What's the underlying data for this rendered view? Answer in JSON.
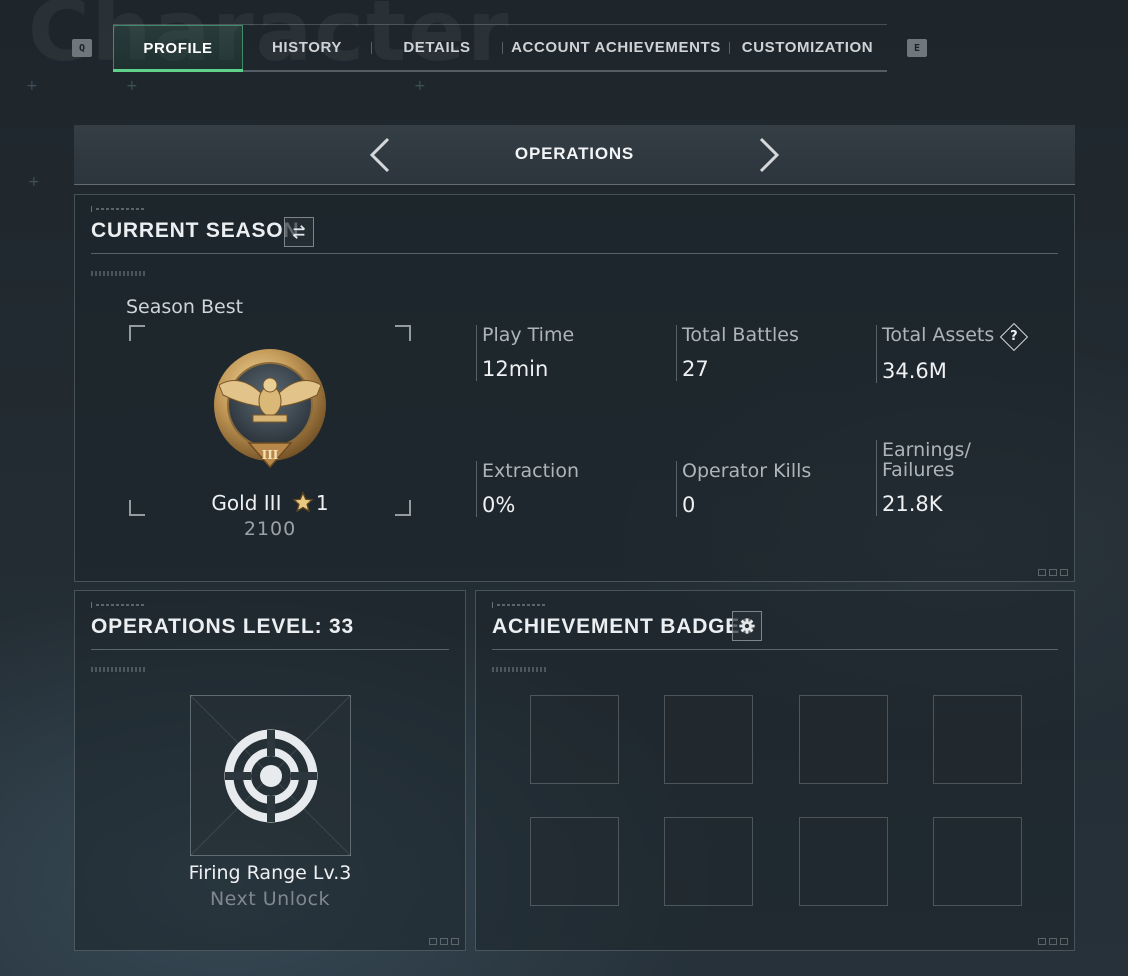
{
  "background_title": "Character",
  "tabs": {
    "prev_key": "Q",
    "next_key": "E",
    "items": [
      {
        "label": "PROFILE",
        "active": true
      },
      {
        "label": "HISTORY",
        "active": false
      },
      {
        "label": "DETAILS",
        "active": false
      },
      {
        "label": "ACCOUNT ACHIEVEMENTS",
        "active": false
      },
      {
        "label": "CUSTOMIZATION",
        "active": false
      }
    ]
  },
  "mode_selector": {
    "title": "OPERATIONS",
    "prev_icon": "chevron-left-icon",
    "next_icon": "chevron-right-icon"
  },
  "current_season": {
    "title": "CURRENT SEASON",
    "switch_icon": "swap-icon",
    "season_best_label": "Season Best",
    "rank": {
      "name": "Gold III",
      "stars": "1",
      "score": "2100",
      "medal_numeral": "III",
      "medal_icon": "gold-eagle-medal-icon"
    },
    "stats": [
      {
        "label": "Play Time",
        "value": "12min"
      },
      {
        "label": "Total Battles",
        "value": "27"
      },
      {
        "label": "Total Assets",
        "value": "34.6M",
        "help": "?"
      },
      {
        "label": "Extraction",
        "value": "0%"
      },
      {
        "label": "Operator Kills",
        "value": "0"
      },
      {
        "label": "Earnings/\nFailures",
        "value": "21.8K"
      }
    ]
  },
  "operations_level": {
    "title": "OPERATIONS LEVEL: 33",
    "next_unlock": {
      "name": "Firing Range Lv.3",
      "caption": "Next Unlock",
      "icon": "target-icon"
    }
  },
  "achievement_badges": {
    "title": "ACHIEVEMENT BADGES",
    "settings_icon": "gear-icon",
    "slot_count": 8
  },
  "colors": {
    "accent_green": "#5fd08a",
    "gold": "#c9a560",
    "text_primary": "#eef0f2",
    "text_muted": "#aeb5ba"
  }
}
